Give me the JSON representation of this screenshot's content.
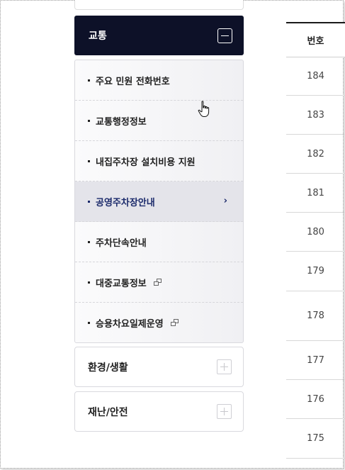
{
  "sidebar": {
    "open_menu": {
      "title": "교통"
    },
    "submenu": [
      {
        "label": "주요 민원 전화번호"
      },
      {
        "label": "교통행정정보"
      },
      {
        "label": "내집주차장 설치비용 지원"
      },
      {
        "label": "공영주차장안내",
        "active": true
      },
      {
        "label": "주차단속안내"
      },
      {
        "label": "대중교통정보",
        "external": true
      },
      {
        "label": "승용차요일제운영",
        "external": true
      }
    ],
    "closed_menus": [
      {
        "title": "환경/생활"
      },
      {
        "title": "재난/안전"
      }
    ]
  },
  "table": {
    "header": "번호",
    "rows": [
      "184",
      "183",
      "182",
      "181",
      "180",
      "179",
      "178",
      "177",
      "176",
      "175"
    ]
  },
  "colors": {
    "menu_head_bg": "#0d1128",
    "active_text": "#1b2a6b"
  }
}
